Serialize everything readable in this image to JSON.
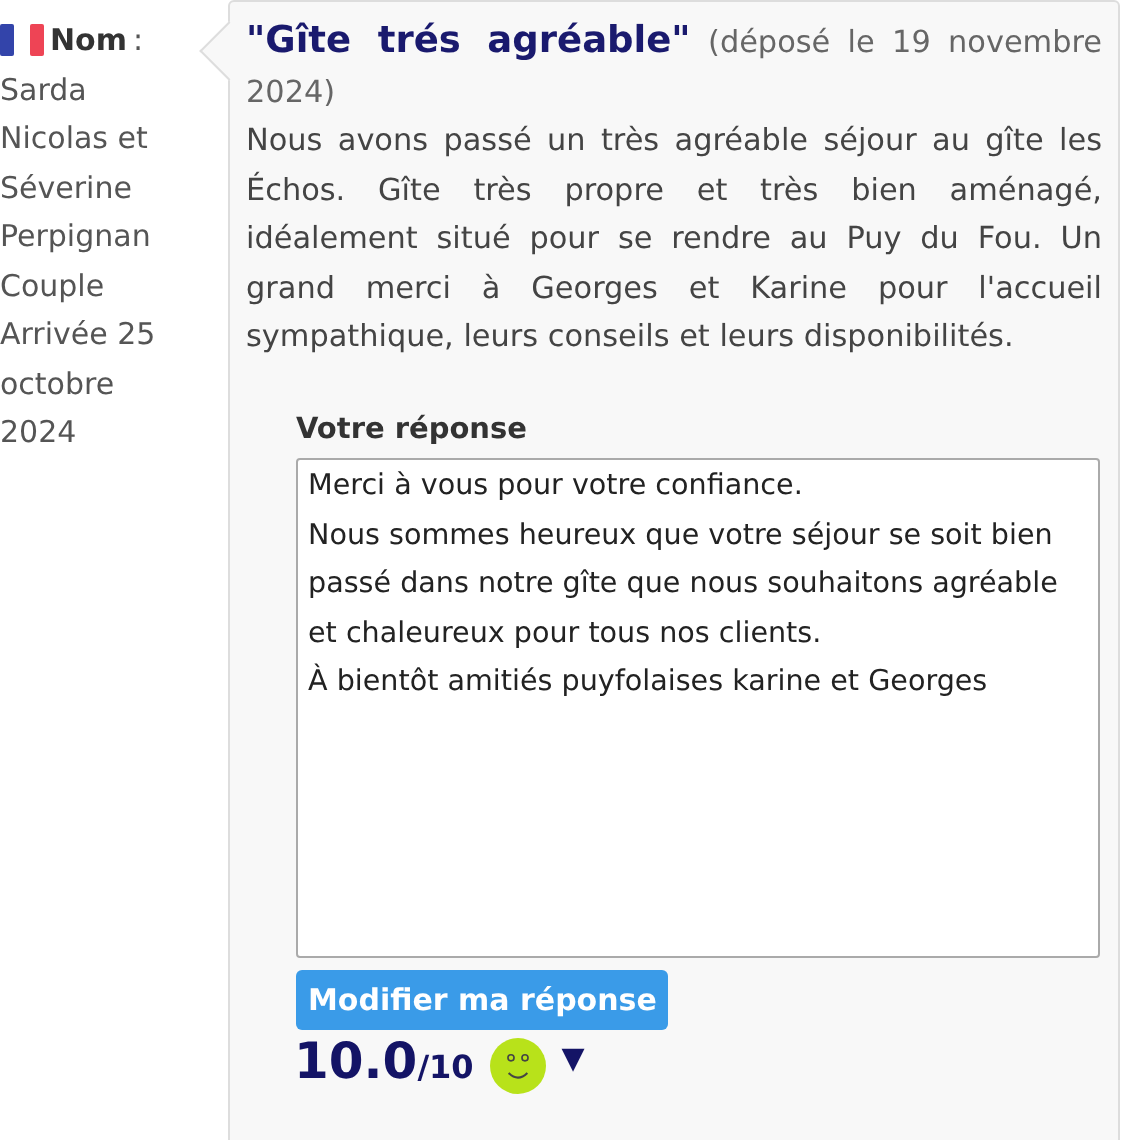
{
  "reviewer": {
    "label": "Nom",
    "separator": ":",
    "name": "Sarda Nicolas et Séverine",
    "city": "Perpignan",
    "group": "Couple",
    "arrival": "Arrivée 25 octobre 2024"
  },
  "review": {
    "title": "\"Gîte trés agréable\"",
    "date": "(déposé le 19 novembre 2024)",
    "text": "Nous avons passé un très agréable séjour au gîte les Échos. Gîte très propre et très bien aménagé, idéalement situé pour se rendre au Puy du Fou. Un grand merci à Georges et Karine pour l'accueil sympathique, leurs conseils et leurs disponibilités."
  },
  "response": {
    "label": "Votre réponse",
    "value": "Merci à vous pour votre confiance.\nNous sommes heureux que votre séjour se soit bien passé dans notre gîte que nous souhaitons agréable et chaleureux pour tous nos clients.\nÀ bientôt amitiés puyfolaises karine et Georges",
    "button": "Modifier ma réponse"
  },
  "score": {
    "value": "10.0",
    "max": "/10",
    "toggle": "▼"
  }
}
